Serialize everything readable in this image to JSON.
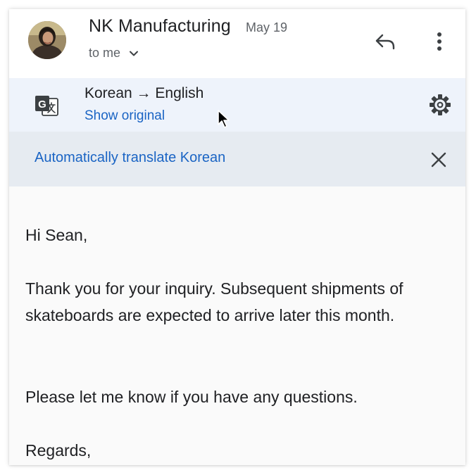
{
  "header": {
    "sender_name": "NK Manufacturing",
    "date": "May 19",
    "recipient": "to me"
  },
  "translation": {
    "language_pair": "Korean → English",
    "show_original_label": "Show original",
    "auto_translate_label": "Automatically translate Korean"
  },
  "message": {
    "greeting": "Hi Sean,",
    "paragraph1": "Thank you for your inquiry. Subsequent shipments of skateboards are expected to arrive later this month.",
    "paragraph2": "Please let me know if you have any questions.",
    "closing": "Regards,"
  },
  "icons": {
    "reply": "reply-icon",
    "more": "more-vert-icon",
    "translate": "translate-icon",
    "settings": "gear-icon",
    "close": "close-icon",
    "chevron": "chevron-down-icon"
  },
  "colors": {
    "link": "#1a64c4",
    "translate_bar_bg": "#eef3fb",
    "auto_bar_bg": "#e6ebf1",
    "text_primary": "#202124",
    "text_secondary": "#5f6368"
  }
}
